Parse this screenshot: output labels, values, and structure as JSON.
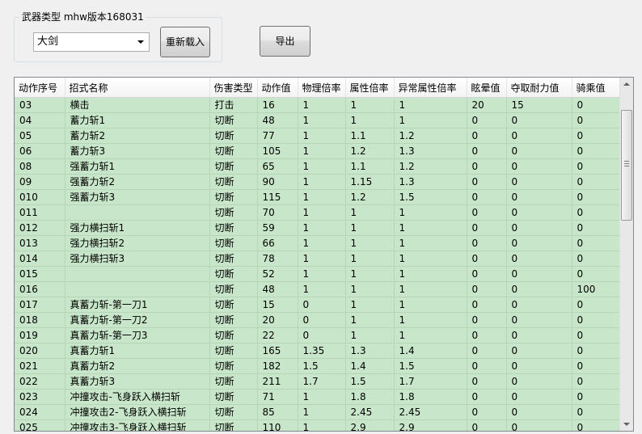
{
  "group": {
    "title": "武器类型 mhw版本168031"
  },
  "weapon_select": {
    "value": "大剑"
  },
  "buttons": {
    "reload": "重新载入",
    "export": "导出"
  },
  "table": {
    "columns": [
      "动作序号",
      "招式名称",
      "伤害类型",
      "动作值",
      "物理倍率",
      "属性倍率",
      "异常属性倍率",
      "眩晕值",
      "夺取耐力值",
      "骑乘值"
    ],
    "rows": [
      [
        "03",
        "横击",
        "打击",
        "16",
        "1",
        "1",
        "1",
        "20",
        "15",
        "0"
      ],
      [
        "04",
        "蓄力斩1",
        "切断",
        "48",
        "1",
        "1",
        "1",
        "0",
        "0",
        "0"
      ],
      [
        "05",
        "蓄力斩2",
        "切断",
        "77",
        "1",
        "1.1",
        "1.2",
        "0",
        "0",
        "0"
      ],
      [
        "06",
        "蓄力斩3",
        "切断",
        "105",
        "1",
        "1.2",
        "1.3",
        "0",
        "0",
        "0"
      ],
      [
        "08",
        "强蓄力斩1",
        "切断",
        "65",
        "1",
        "1.1",
        "1.2",
        "0",
        "0",
        "0"
      ],
      [
        "09",
        "强蓄力斩2",
        "切断",
        "90",
        "1",
        "1.15",
        "1.3",
        "0",
        "0",
        "0"
      ],
      [
        "010",
        "强蓄力斩3",
        "切断",
        "115",
        "1",
        "1.2",
        "1.5",
        "0",
        "0",
        "0"
      ],
      [
        "011",
        "",
        "切断",
        "70",
        "1",
        "1",
        "1",
        "0",
        "0",
        "0"
      ],
      [
        "012",
        "强力横扫斩1",
        "切断",
        "59",
        "1",
        "1",
        "1",
        "0",
        "0",
        "0"
      ],
      [
        "013",
        "强力横扫斩2",
        "切断",
        "66",
        "1",
        "1",
        "1",
        "0",
        "0",
        "0"
      ],
      [
        "014",
        "强力横扫斩3",
        "切断",
        "78",
        "1",
        "1",
        "1",
        "0",
        "0",
        "0"
      ],
      [
        "015",
        "",
        "切断",
        "52",
        "1",
        "1",
        "1",
        "0",
        "0",
        "0"
      ],
      [
        "016",
        "",
        "切断",
        "48",
        "1",
        "1",
        "1",
        "0",
        "0",
        "100"
      ],
      [
        "017",
        "真蓄力斩-第一刀1",
        "切断",
        "15",
        "0",
        "1",
        "1",
        "0",
        "0",
        "0"
      ],
      [
        "018",
        "真蓄力斩-第一刀2",
        "切断",
        "20",
        "0",
        "1",
        "1",
        "0",
        "0",
        "0"
      ],
      [
        "019",
        "真蓄力斩-第一刀3",
        "切断",
        "22",
        "0",
        "1",
        "1",
        "0",
        "0",
        "0"
      ],
      [
        "020",
        "真蓄力斩1",
        "切断",
        "165",
        "1.35",
        "1.3",
        "1.4",
        "0",
        "0",
        "0"
      ],
      [
        "021",
        "真蓄力斩2",
        "切断",
        "182",
        "1.5",
        "1.4",
        "1.5",
        "0",
        "0",
        "0"
      ],
      [
        "022",
        "真蓄力斩3",
        "切断",
        "211",
        "1.7",
        "1.5",
        "1.7",
        "0",
        "0",
        "0"
      ],
      [
        "023",
        "冲撞攻击-飞身跃入横扫斩",
        "切断",
        "71",
        "1",
        "1.8",
        "1.8",
        "0",
        "0",
        "0"
      ],
      [
        "024",
        "冲撞攻击2-飞身跃入横扫斩",
        "切断",
        "85",
        "1",
        "2.45",
        "2.45",
        "0",
        "0",
        "0"
      ],
      [
        "025",
        "冲撞攻击3-飞身跃入横扫斩",
        "切断",
        "110",
        "1",
        "2.9",
        "2.9",
        "0",
        "0",
        "0"
      ]
    ]
  },
  "colors": {
    "row_bg": "#c8e6c9",
    "row_grid": "#b8d4b9"
  },
  "icons": {
    "combo": "chevron-down-icon",
    "scroll_up": "scroll-up-arrow-icon",
    "scroll_down": "scroll-down-arrow-icon"
  }
}
